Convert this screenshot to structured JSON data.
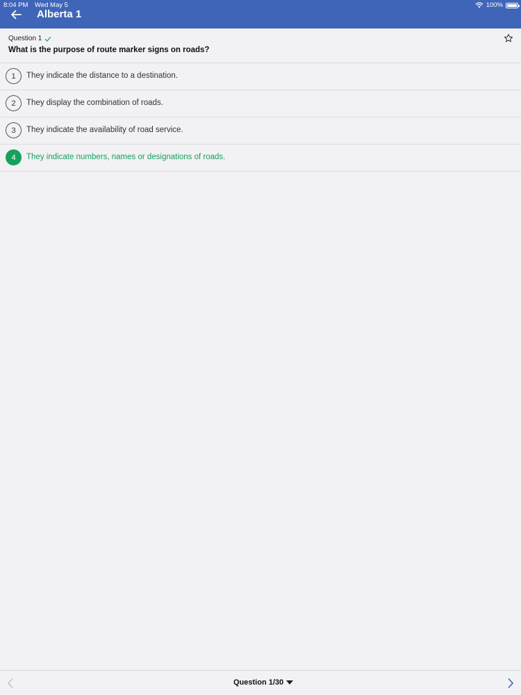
{
  "status_bar": {
    "time": "8:04 PM",
    "date": "Wed May 5",
    "battery": "100%"
  },
  "header": {
    "title": "Alberta 1",
    "back_icon": "arrow-left-icon",
    "background": "#3f65b8"
  },
  "question": {
    "number_label": "Question 1",
    "text": "What is the purpose of route marker signs on roads?",
    "status_icon": "check-icon",
    "favorite_icon": "star-outline-icon"
  },
  "answers": [
    {
      "number": "1",
      "text": "They indicate the distance to a destination.",
      "correct": false
    },
    {
      "number": "2",
      "text": "They display the combination of roads.",
      "correct": false
    },
    {
      "number": "3",
      "text": "They indicate the availability of road service.",
      "correct": false
    },
    {
      "number": "4",
      "text": "They indicate numbers, names or designations of roads.",
      "correct": true
    }
  ],
  "colors": {
    "correct": "#16a05d",
    "accent": "#3f65b8"
  },
  "footer": {
    "selector_label": "Question 1/30",
    "prev_icon": "chevron-left-icon",
    "next_icon": "chevron-right-icon"
  }
}
